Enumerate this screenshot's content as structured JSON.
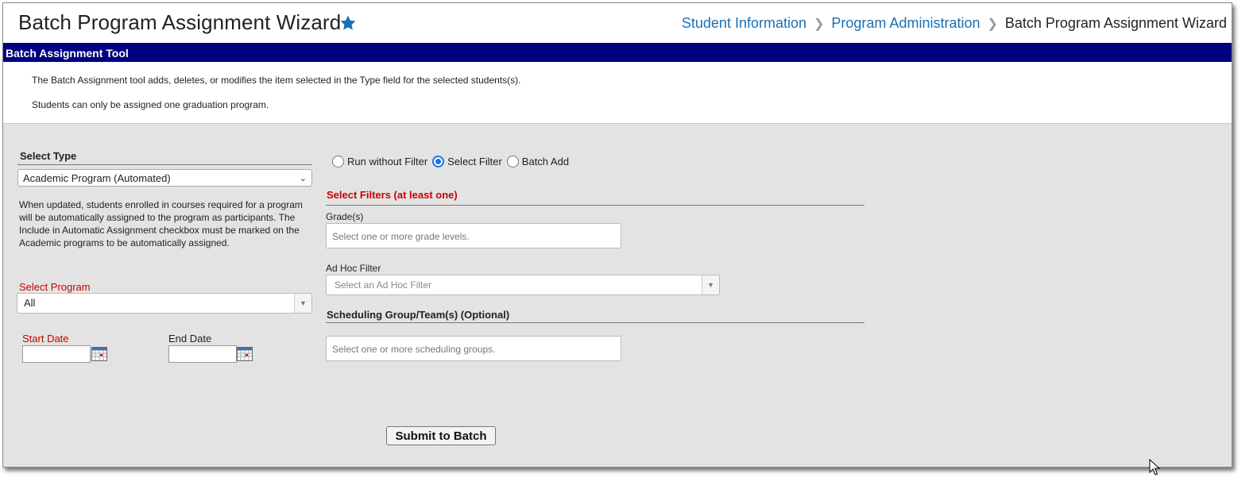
{
  "header": {
    "title": "Batch Program Assignment Wizard",
    "breadcrumb": [
      "Student Information",
      "Program Administration",
      "Batch Program Assignment Wizard"
    ]
  },
  "toolbar": {
    "title": "Batch Assignment Tool"
  },
  "intro": {
    "line1": "The Batch Assignment tool adds, deletes, or modifies the item selected in the Type field for the selected students(s).",
    "line2": "Students can only be assigned one graduation program."
  },
  "left": {
    "select_type_label": "Select Type",
    "select_type_value": "Academic Program (Automated)",
    "description": "When updated, students enrolled in courses required for a program will be automatically assigned to the program as participants. The Include in Automatic Assignment checkbox must be marked on the Academic programs to be automatically assigned.",
    "select_program_label": "Select Program",
    "select_program_value": "All",
    "start_date_label": "Start Date",
    "end_date_label": "End Date",
    "start_date_value": "",
    "end_date_value": ""
  },
  "right": {
    "radio_options": [
      "Run without Filter",
      "Select Filter",
      "Batch Add"
    ],
    "selected_radio": "Select Filter",
    "filters_heading": "Select Filters (at least one)",
    "grades_label": "Grade(s)",
    "grades_placeholder": "Select one or more grade levels.",
    "adhoc_label": "Ad Hoc Filter",
    "adhoc_placeholder": "Select an Ad Hoc Filter",
    "sched_heading": "Scheduling Group/Team(s) (Optional)",
    "sched_placeholder": "Select one or more scheduling groups."
  },
  "submit_label": "Submit to Batch",
  "colors": {
    "toolbar_bg": "#000080",
    "link": "#1a6fb5",
    "required": "#cc0000",
    "accent_radio": "#1a73e8",
    "star": "#1a6fb5"
  }
}
